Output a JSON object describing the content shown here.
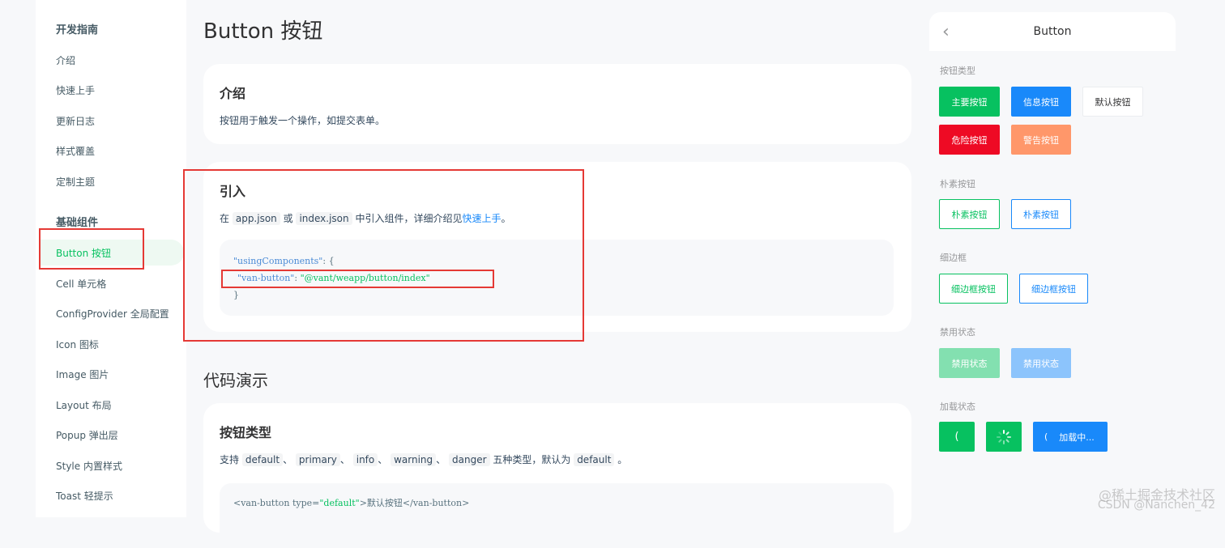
{
  "sidebar": {
    "group1": "开发指南",
    "guide_items": [
      "介绍",
      "快速上手",
      "更新日志",
      "样式覆盖",
      "定制主题"
    ],
    "group2": "基础组件",
    "component_items": [
      "Button 按钮",
      "Cell 单元格",
      "ConfigProvider 全局配置",
      "Icon 图标",
      "Image 图片",
      "Layout 布局",
      "Popup 弹出层",
      "Style 内置样式",
      "Toast 轻提示"
    ],
    "active_item": "Button 按钮"
  },
  "main": {
    "title": "Button 按钮",
    "intro": {
      "heading": "介绍",
      "text": "按钮用于触发一个操作，如提交表单。"
    },
    "import": {
      "heading": "引入",
      "text_before": "在",
      "chip1": "app.json",
      "text_or": "或",
      "chip2": "index.json",
      "text_middle": "中引入组件，详细介绍见",
      "link": "快速上手",
      "text_end": "。",
      "code": {
        "line1_key": "\"usingComponents\"",
        "line1_rest": ": {",
        "line2_key": "\"van-button\"",
        "line2_sep": ": ",
        "line2_val": "\"@vant/weapp/button/index\"",
        "line3": "}"
      }
    },
    "demo_section_title": "代码演示",
    "types": {
      "heading": "按钮类型",
      "text_prefix": "支持",
      "chips": [
        "default",
        "primary",
        "info",
        "warning",
        "danger"
      ],
      "sep": "、",
      "text_middle": "五种类型，默认为",
      "default_chip": "default",
      "text_end": "。",
      "code_line1_a": "<van-button type=",
      "code_line1_b": "\"default\"",
      "code_line1_c": ">默认按钮</van-button>"
    }
  },
  "phone": {
    "back_icon": "chevron-left-icon",
    "nav_title": "Button",
    "section_types": "按钮类型",
    "btn_primary": "主要按钮",
    "btn_info": "信息按钮",
    "btn_default": "默认按钮",
    "btn_danger": "危险按钮",
    "btn_warning": "警告按钮",
    "section_plain": "朴素按钮",
    "btn_plain1": "朴素按钮",
    "btn_plain2": "朴素按钮",
    "section_hairline": "细边框",
    "btn_hairline1": "细边框按钮",
    "btn_hairline2": "细边框按钮",
    "section_disabled": "禁用状态",
    "btn_disabled1": "禁用状态",
    "btn_disabled2": "禁用状态",
    "section_loading": "加载状态",
    "btn_loading_text": "加载中...",
    "colors": {
      "primary": "#07c160",
      "info": "#1989fa",
      "danger": "#ee0a24",
      "warning": "#ff976a"
    }
  },
  "watermark": {
    "line1": "@稀土掘金技术社区",
    "line2": "CSDN @Nanchen_42"
  }
}
